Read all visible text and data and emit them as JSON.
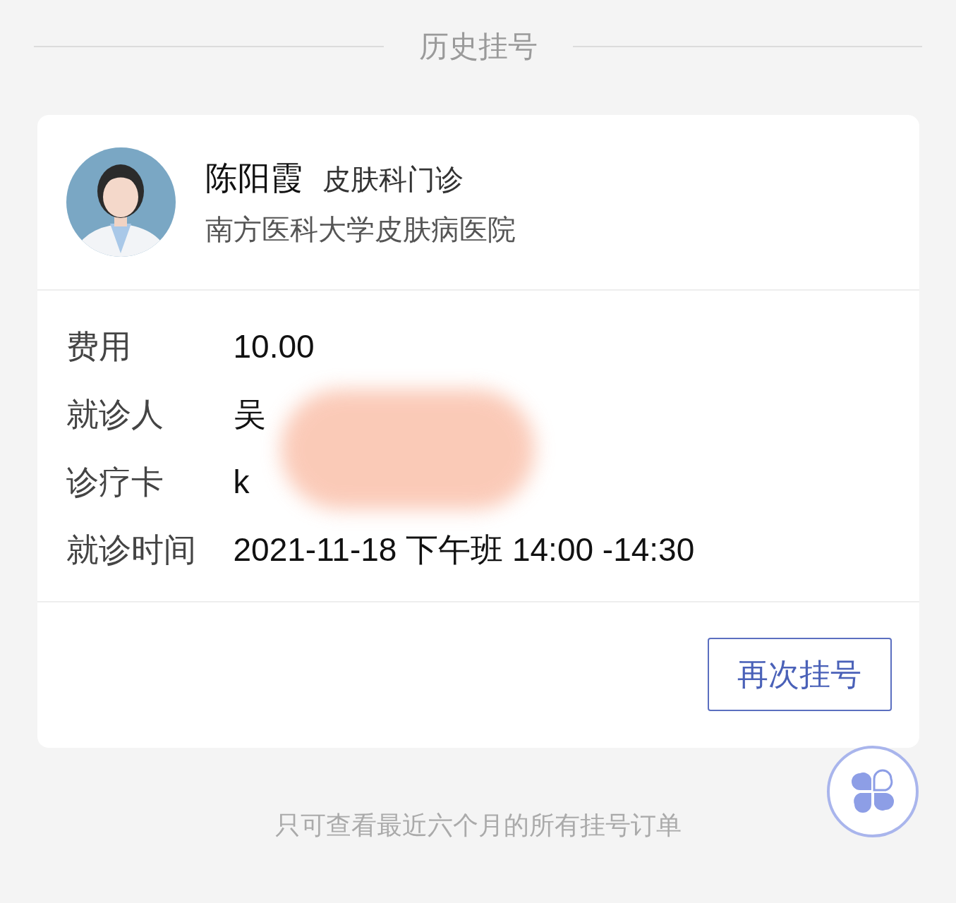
{
  "header": {
    "title": "历史挂号"
  },
  "card": {
    "doctor": {
      "name": "陈阳霞",
      "department": "皮肤科门诊",
      "hospital": "南方医科大学皮肤病医院"
    },
    "details": [
      {
        "label": "费用",
        "value": "10.00"
      },
      {
        "label": "就诊人",
        "value": "吴"
      },
      {
        "label": "诊疗卡",
        "value": "k"
      },
      {
        "label": "就诊时间",
        "value": "2021-11-18 下午班 14:00 -14:30"
      }
    ],
    "button": "再次挂号"
  },
  "footer_note": "只可查看最近六个月的所有挂号订单"
}
